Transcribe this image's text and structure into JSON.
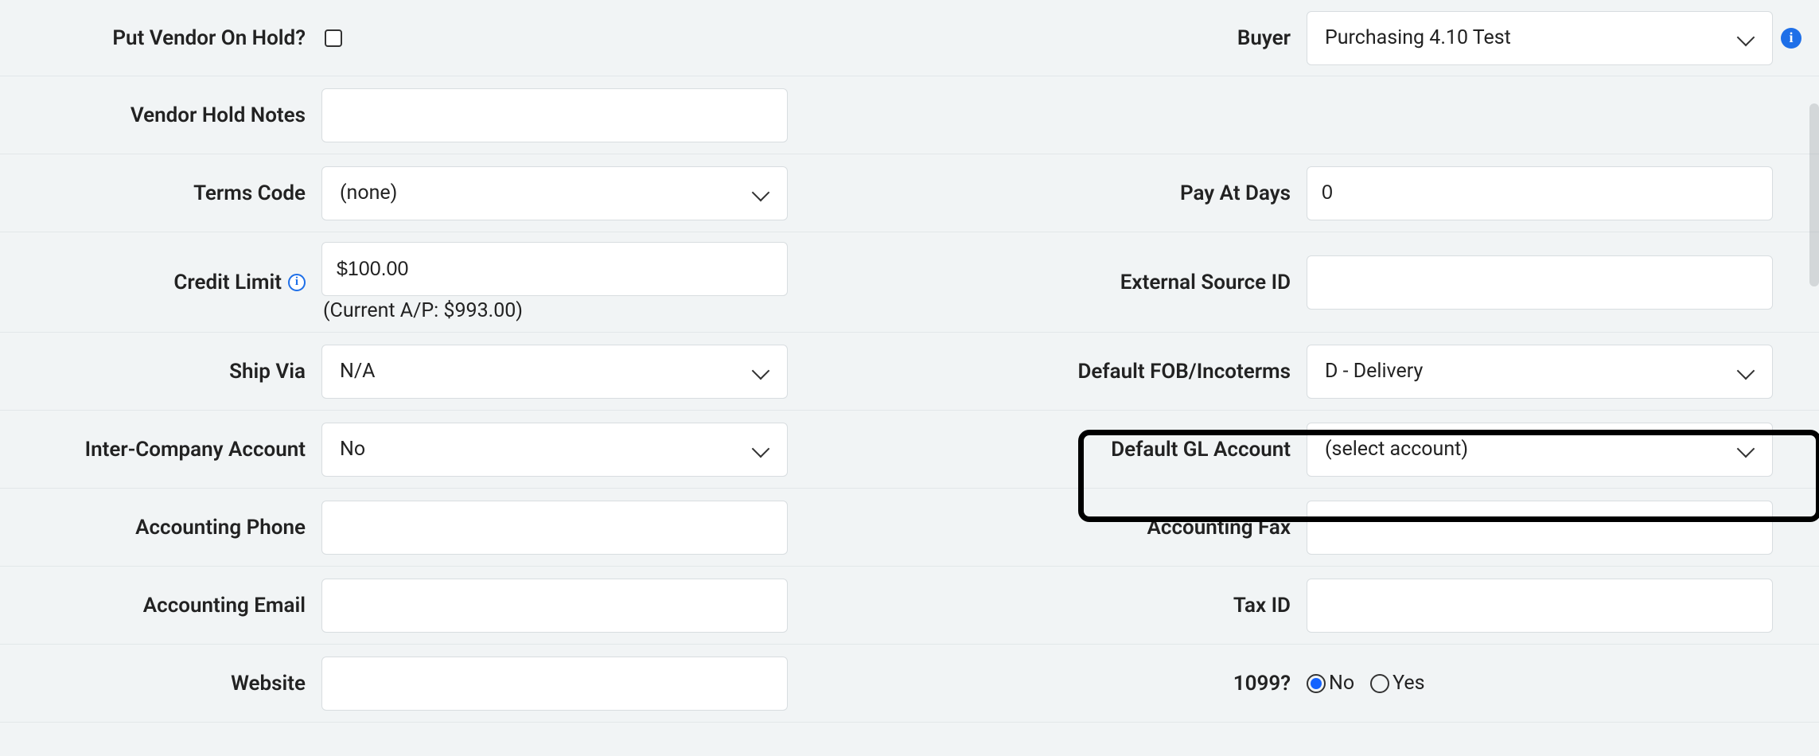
{
  "row1": {
    "left_label": "Put Vendor On Hold?",
    "right_label": "Buyer",
    "buyer_value": "Purchasing 4.10 Test"
  },
  "row2": {
    "left_label": "Vendor Hold Notes",
    "notes_value": ""
  },
  "row3": {
    "left_label": "Terms Code",
    "terms_value": "(none)",
    "right_label": "Pay At Days",
    "pay_at_days_value": "0"
  },
  "row4": {
    "left_label": "Credit Limit",
    "credit_limit_value": "$100.00",
    "credit_limit_help": "(Current A/P: $993.00)",
    "right_label": "External Source ID",
    "external_id_value": ""
  },
  "row5": {
    "left_label": "Ship Via",
    "ship_via_value": "N/A",
    "right_label": "Default FOB/Incoterms",
    "fob_value": "D - Delivery"
  },
  "row6": {
    "left_label": "Inter-Company Account",
    "intercompany_value": "No",
    "right_label": "Default GL Account",
    "gl_value": "(select account)"
  },
  "row7": {
    "left_label": "Accounting Phone",
    "phone_value": "",
    "right_label": "Accounting Fax",
    "fax_value": ""
  },
  "row8": {
    "left_label": "Accounting Email",
    "email_value": "",
    "right_label": "Tax ID",
    "taxid_value": ""
  },
  "row9": {
    "left_label": "Website",
    "website_value": "",
    "right_label": "1099?",
    "radio_no": "No",
    "radio_yes": "Yes"
  },
  "icons": {
    "info": "i"
  }
}
